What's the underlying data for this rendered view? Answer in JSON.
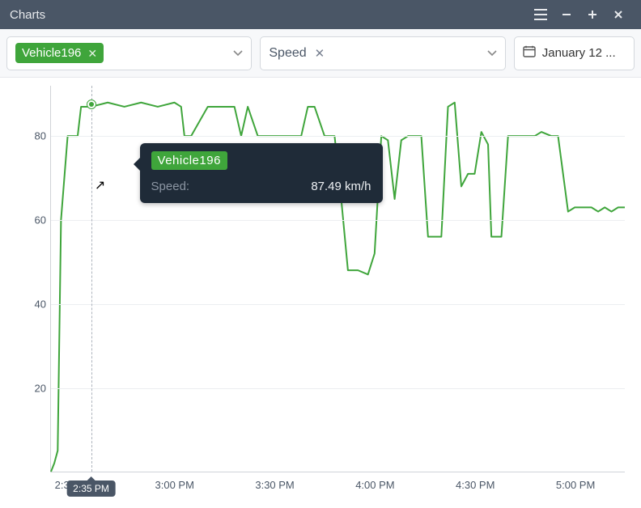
{
  "window": {
    "title": "Charts"
  },
  "toolbar": {
    "vehicle_chip": "Vehicle196",
    "metric_label": "Speed",
    "date_label": "January 12 ..."
  },
  "tooltip": {
    "series": "Vehicle196",
    "key": "Speed:",
    "value": "87.49 km/h"
  },
  "time_flag": "2:35 PM",
  "chart_data": {
    "type": "line",
    "title": "",
    "xlabel": "",
    "ylabel": "",
    "ylim": [
      0,
      92
    ],
    "y_ticks": [
      20,
      40,
      60,
      80
    ],
    "x_ticks": [
      "2:30 PM",
      "3:00 PM",
      "3:30 PM",
      "4:00 PM",
      "4:30 PM",
      "5:00 PM"
    ],
    "x_range_minutes": [
      143,
      315
    ],
    "hover_x_minute": 155,
    "hover_value": 87.49,
    "series": [
      {
        "name": "Vehicle196",
        "color": "#3fa53b",
        "x_minutes": [
          143,
          144,
          145,
          146,
          148,
          150,
          151,
          152,
          155,
          160,
          165,
          170,
          175,
          180,
          182,
          183,
          185,
          190,
          195,
          198,
          200,
          202,
          205,
          210,
          215,
          218,
          220,
          222,
          225,
          228,
          230,
          232,
          235,
          238,
          240,
          242,
          244,
          246,
          248,
          250,
          252,
          254,
          256,
          258,
          260,
          262,
          264,
          266,
          268,
          270,
          272,
          274,
          275,
          278,
          280,
          283,
          285,
          288,
          290,
          293,
          295,
          298,
          300,
          303,
          305,
          307,
          309,
          311,
          313,
          315
        ],
        "values": [
          0,
          2,
          5,
          60,
          80,
          80,
          80,
          87,
          87,
          88,
          87,
          88,
          87,
          88,
          87,
          80,
          80,
          87,
          87,
          87,
          80,
          87,
          80,
          80,
          80,
          80,
          87,
          87,
          80,
          80,
          65,
          48,
          48,
          47,
          52,
          80,
          79,
          65,
          79,
          80,
          80,
          80,
          56,
          56,
          56,
          87,
          88,
          68,
          71,
          71,
          81,
          78,
          56,
          56,
          80,
          80,
          80,
          80,
          81,
          80,
          80,
          62,
          63,
          63,
          63,
          62,
          63,
          62,
          63,
          63
        ]
      }
    ]
  }
}
